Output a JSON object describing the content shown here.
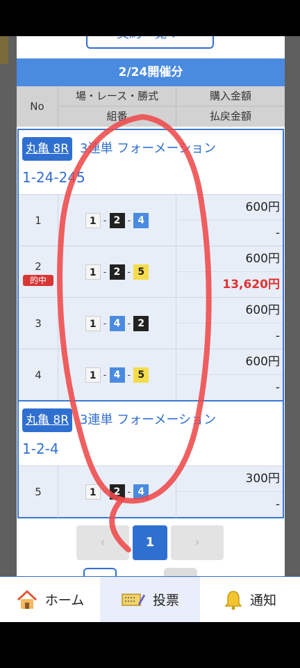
{
  "top_button": {
    "label": "契約一覧 ＞"
  },
  "date_header": "2/24開催分",
  "columns": {
    "no": "No",
    "race": "場・レース・勝式",
    "combo": "組番",
    "amount": "購入金額",
    "refund": "払戻金額"
  },
  "groups": [
    {
      "venue": "丸亀 8R",
      "bet_type": "3連単 フォーメーション",
      "combo": "1-24-245",
      "rows": [
        {
          "no": "1",
          "combo": [
            "1",
            "2",
            "4"
          ],
          "amount": "600円",
          "refund": "-"
        },
        {
          "no": "2",
          "hit": "的中",
          "combo": [
            "1",
            "2",
            "5"
          ],
          "amount": "600円",
          "refund": "13,620円"
        },
        {
          "no": "3",
          "combo": [
            "1",
            "4",
            "2"
          ],
          "amount": "600円",
          "refund": "-"
        },
        {
          "no": "4",
          "combo": [
            "1",
            "4",
            "5"
          ],
          "amount": "600円",
          "refund": "-"
        }
      ]
    },
    {
      "venue": "丸亀 8R",
      "bet_type": "3連単 フォーメーション",
      "combo": "1-2-4",
      "rows": [
        {
          "no": "5",
          "combo": [
            "1",
            "2",
            "4"
          ],
          "amount": "300円",
          "refund": "-"
        }
      ]
    }
  ],
  "pagination": {
    "prev": "‹",
    "current": "1",
    "next": "›"
  },
  "tabs": [
    {
      "label": "ホーム",
      "icon": "home-icon"
    },
    {
      "label": "投票",
      "icon": "ticket-icon"
    },
    {
      "label": "通知",
      "icon": "bell-icon"
    }
  ],
  "colors": {
    "accent": "#2f6fd0",
    "header": "#4a8be0",
    "win": "#e03232",
    "annotation": "#ee4a4a"
  }
}
